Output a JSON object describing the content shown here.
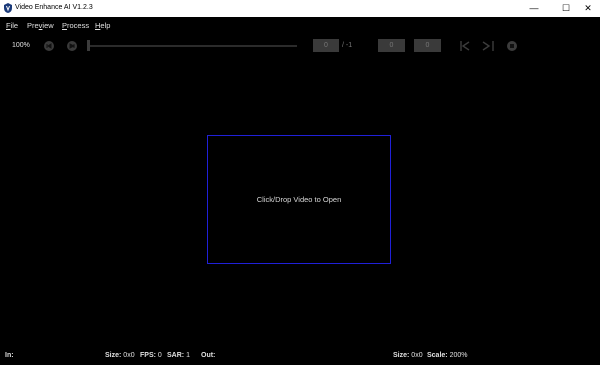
{
  "window": {
    "title": "Video Enhance AI V1.2.3",
    "minimize_glyph": "—",
    "maximize_glyph": "☐",
    "close_glyph": "✕"
  },
  "menu": {
    "file": {
      "key": "F",
      "rest": "ile"
    },
    "preview": {
      "pre": "Pre",
      "key": "v",
      "rest": "iew"
    },
    "process": {
      "key": "P",
      "rest": "rocess"
    },
    "help": {
      "key": "H",
      "rest": "elp"
    }
  },
  "toolbar": {
    "zoom": "100%",
    "current_frame": "0",
    "total_frames": "/ -1",
    "range_start": "0",
    "range_end": "0"
  },
  "main": {
    "drop_text": "Click/Drop Video to Open",
    "accent_color": "#2020d8"
  },
  "status": {
    "in_label": "In:",
    "size_label": "Size:",
    "size_in": "0x0",
    "fps_label": "FPS:",
    "fps_value": "0",
    "sar_label": "SAR:",
    "sar_value": "1",
    "out_label": "Out:",
    "size_out_label": "Size:",
    "size_out": "0x0",
    "scale_label": "Scale:",
    "scale_value": "200%"
  }
}
